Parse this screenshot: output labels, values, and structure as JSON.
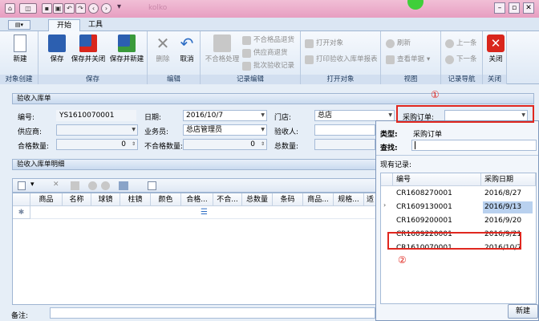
{
  "window": {
    "title_partial": "kolko"
  },
  "tabs": [
    "开始",
    "工具"
  ],
  "ribbon": {
    "groups": [
      {
        "label": "对象创建",
        "buttons": [
          "新建"
        ]
      },
      {
        "label": "保存",
        "buttons": [
          "保存",
          "保存并关闭",
          "保存并新建"
        ]
      },
      {
        "label": "编辑",
        "buttons": [
          "删除",
          "取消"
        ]
      },
      {
        "label": "记录编辑",
        "buttons": [
          "不合格处理",
          "不合格品退货",
          "供应商退货",
          "批次验收记录"
        ]
      },
      {
        "label": "打开对象",
        "buttons": [
          "打开对象",
          "打印验收入库单报表"
        ]
      },
      {
        "label": "视图",
        "buttons": [
          "刷新",
          "查看单据"
        ]
      },
      {
        "label": "记录导航",
        "buttons": [
          "上一条",
          "下一条"
        ]
      },
      {
        "label": "关闭",
        "buttons": [
          "关闭"
        ]
      }
    ]
  },
  "header_panel": {
    "title": "验收入库单",
    "fields": {
      "code_label": "编号:",
      "code_value": "YS1610070001",
      "date_label": "日期:",
      "date_value": "2016/10/7",
      "store_label": "门店:",
      "store_value": "总店",
      "po_label": "采购订单:",
      "po_value": "",
      "supplier_label": "供应商:",
      "supplier_value": "",
      "salesman_label": "业务员:",
      "salesman_value": "总店管理员",
      "inspector_label": "验收人:",
      "inspector_value": "",
      "qualified_label": "合格数量:",
      "qualified_value": "0",
      "unqualified_label": "不合格数量:",
      "unqualified_value": "0",
      "total_label": "总数量:",
      "total_value": ""
    }
  },
  "detail_panel": {
    "title": "验收入库单明细",
    "columns": [
      "商品",
      "名称",
      "球镜",
      "柱镜",
      "颜色",
      "合格...",
      "不合...",
      "总数量",
      "条码",
      "商品...",
      "规格...",
      "适"
    ]
  },
  "remarks_label": "备注:",
  "popup": {
    "type_label": "类型:",
    "type_value": "采购订单",
    "search_label": "查找:",
    "search_value": "",
    "records_label": "现有记录:",
    "columns": [
      "编号",
      "采购日期"
    ],
    "rows": [
      {
        "code": "CR1608270001",
        "date": "2016/8/27"
      },
      {
        "code": "CR1609130001",
        "date": "2016/9/13"
      },
      {
        "code": "CR1609200001",
        "date": "2016/9/20"
      },
      {
        "code": "CR1609220001",
        "date": "2016/9/21"
      },
      {
        "code": "CR1610070001",
        "date": "2016/10/7"
      }
    ],
    "new_button": "新建"
  },
  "annotations": {
    "marker1": "①",
    "marker2": "②"
  },
  "colors": {
    "accent": "#e0271f",
    "selected": "#b9d1ef"
  }
}
